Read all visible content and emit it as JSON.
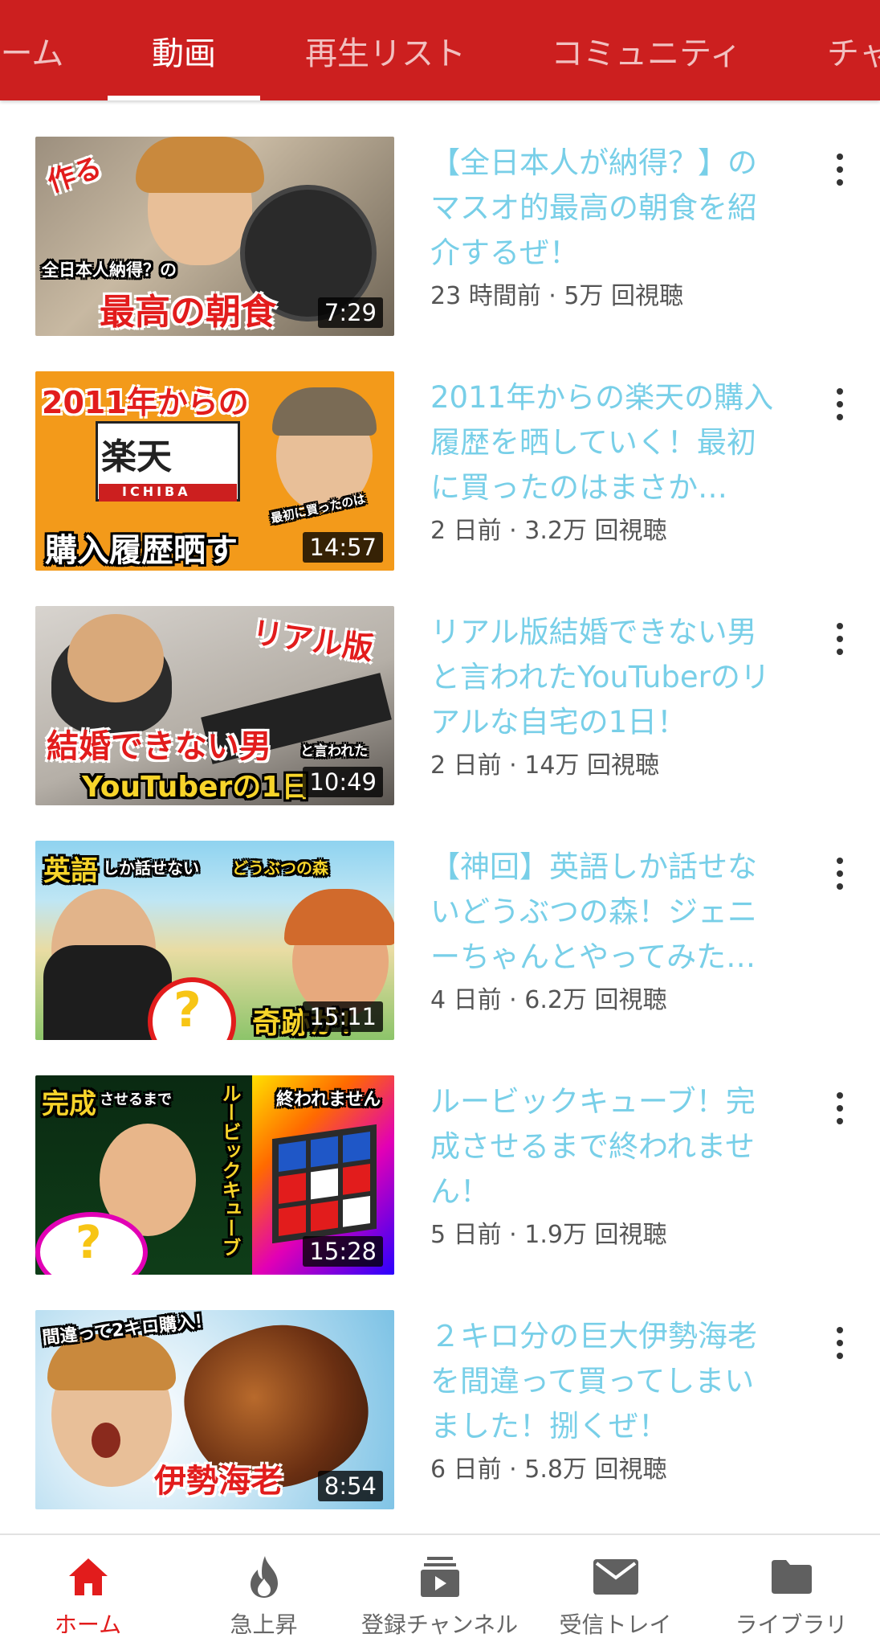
{
  "colors": {
    "header_bg": "#cc1f1f",
    "title_text": "#78cfe8",
    "active_nav": "#e21c1c"
  },
  "tabs": [
    {
      "label": "ーム"
    },
    {
      "label": "動画"
    },
    {
      "label": "再生リスト"
    },
    {
      "label": "コミュニティ"
    },
    {
      "label": "チャ"
    }
  ],
  "active_tab": "動画",
  "videos": [
    {
      "title": "【全日本人が納得？】のマスオ的最高の朝食を紹介するぜ！",
      "meta": "23 時間前 · 5万 回視聴",
      "duration": "7:29",
      "thumb_text": [
        "作る",
        "全日本人納得？の",
        "最高の朝食"
      ]
    },
    {
      "title": "2011年からの楽天の購入履歴を晒していく！最初に買ったのはまさか…",
      "meta": "2 日前 · 3.2万 回視聴",
      "duration": "14:57",
      "thumb_text": [
        "2011年からの",
        "楽天",
        "ICHIBA",
        "購入履歴晒す",
        "最初に買ったのは"
      ]
    },
    {
      "title": "リアル版結婚できない男と言われたYouTuberのリアルな自宅の1日！",
      "meta": "2 日前 · 14万 回視聴",
      "duration": "10:49",
      "thumb_text": [
        "リアル版",
        "結婚できない男",
        "と言われた",
        "YouTuberの1日"
      ]
    },
    {
      "title": "【神回】英語しか話せないどうぶつの森！ジェニーちゃんとやってみた…",
      "meta": "4 日前 · 6.2万 回視聴",
      "duration": "15:11",
      "thumb_text": [
        "英語",
        "しか話せない",
        "どうぶつの森",
        "奇跡が！"
      ]
    },
    {
      "title": "ルービックキューブ！完成させるまで終われません！",
      "meta": "5 日前 · 1.9万 回視聴",
      "duration": "15:28",
      "thumb_text": [
        "完成",
        "させるまで",
        "ルービックキューブ",
        "終われません"
      ]
    },
    {
      "title": "２キロ分の巨大伊勢海老を間違って買ってしまいました！捌くぜ！",
      "meta": "6 日前 · 5.8万 回視聴",
      "duration": "8:54",
      "thumb_text": [
        "間違って2キロ購入！",
        "伊勢海老"
      ]
    }
  ],
  "bottom_nav": [
    {
      "label": "ホーム",
      "icon": "home-icon",
      "active": true
    },
    {
      "label": "急上昇",
      "icon": "flame-icon",
      "active": false
    },
    {
      "label": "登録チャンネル",
      "icon": "subscriptions-icon",
      "active": false
    },
    {
      "label": "受信トレイ",
      "icon": "mail-icon",
      "active": false
    },
    {
      "label": "ライブラリ",
      "icon": "folder-icon",
      "active": false
    }
  ]
}
